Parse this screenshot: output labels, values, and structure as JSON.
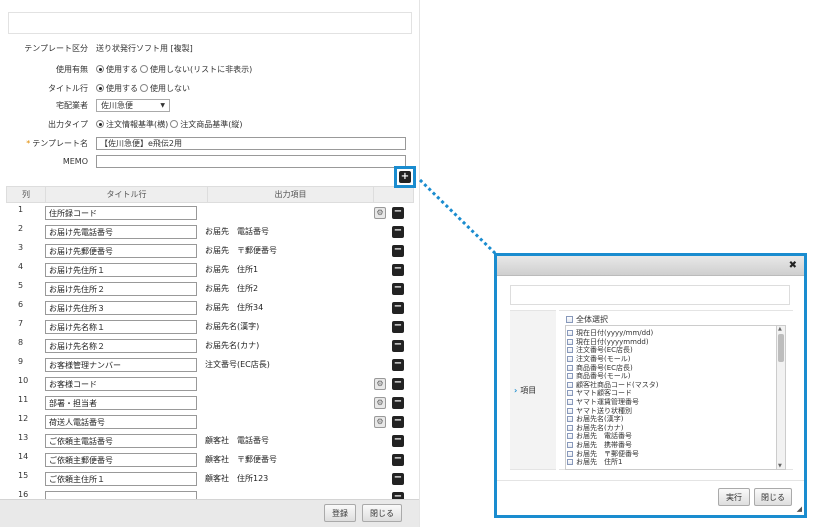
{
  "form": {
    "template_type_label": "テンプレート区分",
    "template_type_value": "送り状発行ソフト用 [複製]",
    "usage_label": "使用有無",
    "usage_opt1": "使用する",
    "usage_opt2": "使用しない(リストに非表示)",
    "title_row_label": "タイトル行",
    "title_opt1": "使用する",
    "title_opt2": "使用しない",
    "carrier_label": "宅配業者",
    "carrier_value": "佐川急便",
    "output_type_label": "出力タイプ",
    "output_opt1": "注文情報基準(横)",
    "output_opt2": "注文商品基準(縦)",
    "template_name_label": "テンプレート名",
    "required_mark": "*",
    "template_name_value": "【佐川急便】e飛伝2用",
    "memo_label": "MEMO",
    "memo_value": "",
    "add_symbol": "+"
  },
  "table": {
    "col_num": "列",
    "col_title": "タイトル行",
    "col_output": "出力項目",
    "rows": [
      {
        "num": "1",
        "title": "住所録コード",
        "output": "",
        "gear": true
      },
      {
        "num": "2",
        "title": "お届け先電話番号",
        "output": "お届先　電話番号",
        "gear": false
      },
      {
        "num": "3",
        "title": "お届け先郵便番号",
        "output": "お届先　〒郵便番号",
        "gear": false
      },
      {
        "num": "4",
        "title": "お届け先住所１",
        "output": "お届先　住所1",
        "gear": false
      },
      {
        "num": "5",
        "title": "お届け先住所２",
        "output": "お届先　住所2",
        "gear": false
      },
      {
        "num": "6",
        "title": "お届け先住所３",
        "output": "お届先　住所34",
        "gear": false
      },
      {
        "num": "7",
        "title": "お届け先名称１",
        "output": "お届先名(漢字)",
        "gear": false
      },
      {
        "num": "8",
        "title": "お届け先名称２",
        "output": "お届先名(カナ)",
        "gear": false
      },
      {
        "num": "9",
        "title": "お客様管理ナンバー",
        "output": "注文番号(EC店長)",
        "gear": false
      },
      {
        "num": "10",
        "title": "お客様コード",
        "output": "",
        "gear": true
      },
      {
        "num": "11",
        "title": "部署・担当者",
        "output": "",
        "gear": true
      },
      {
        "num": "12",
        "title": "荷送人電話番号",
        "output": "",
        "gear": true
      },
      {
        "num": "13",
        "title": "ご依頼主電話番号",
        "output": "顧客社　電話番号",
        "gear": false
      },
      {
        "num": "14",
        "title": "ご依頼主郵便番号",
        "output": "顧客社　〒郵便番号",
        "gear": false
      },
      {
        "num": "15",
        "title": "ご依頼主住所１",
        "output": "顧客社　住所123",
        "gear": false
      },
      {
        "num": "16",
        "title": "",
        "output": "",
        "gear": false
      }
    ],
    "minus_symbol": "−",
    "gear_symbol": "⚙"
  },
  "footer": {
    "register_label": "登録",
    "close_label": "閉じる"
  },
  "dialog": {
    "close_symbol": "✖",
    "field_label": "項目",
    "select_all": "全体選択",
    "items": [
      "現在日付(yyyy/mm/dd)",
      "現在日付(yyyymmdd)",
      "注文番号(EC店長)",
      "注文番号(モール)",
      "商品番号(EC店長)",
      "商品番号(モール)",
      "顧客社商品コード(マスタ)",
      "ヤマト顧客コード",
      "ヤマト運賃管理番号",
      "ヤマト送り状種別",
      "お届先名(漢字)",
      "お届先名(カナ)",
      "お届先　電話番号",
      "お届先　携帯番号",
      "お届先　〒郵便番号",
      "お届先　住所1"
    ],
    "run_label": "実行",
    "close_label": "閉じる"
  },
  "colors": {
    "accent": "#1a8ccf",
    "required": "#e08a00"
  }
}
